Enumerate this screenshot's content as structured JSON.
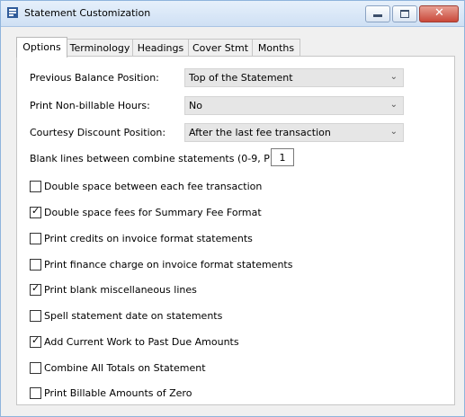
{
  "window": {
    "title": "Statement Customization",
    "close_glyph": "✕"
  },
  "tabs": [
    "Options",
    "Terminology",
    "Headings",
    "Cover Stmt",
    "Months"
  ],
  "fields": {
    "previous_balance": {
      "label": "Previous Balance Position:",
      "value": "Top of the Statement"
    },
    "nonbillable": {
      "label": "Print Non-billable Hours:",
      "value": "No"
    },
    "courtesy": {
      "label": "Courtesy Discount Position:",
      "value": "After the last fee transaction"
    },
    "blank_lines": {
      "label": "Blank lines between combine statements (0-9, P):",
      "value": "1"
    }
  },
  "checkboxes": [
    {
      "label": "Double space between each fee transaction",
      "checked": false
    },
    {
      "label": "Double space fees for Summary Fee Format",
      "checked": true
    },
    {
      "label": "Print credits on invoice format statements",
      "checked": false
    },
    {
      "label": "Print finance charge on invoice format statements",
      "checked": false
    },
    {
      "label": "Print blank miscellaneous lines",
      "checked": true
    },
    {
      "label": "Spell statement date on statements",
      "checked": false
    },
    {
      "label": "Add Current Work to Past Due Amounts",
      "checked": true
    },
    {
      "label": "Combine All Totals on Statement",
      "checked": false
    },
    {
      "label": "Print Billable Amounts of Zero",
      "checked": false
    }
  ],
  "icons": {
    "app": "app-form-icon",
    "minimize": "minimize-icon",
    "maximize": "maximize-icon",
    "close": "close-icon",
    "chevron": "chevron-down-icon",
    "check": "✓"
  },
  "colors": {
    "title_bar": "#cfe0f4",
    "close_button": "#c9483a",
    "select_bg": "#e6e6e6"
  }
}
